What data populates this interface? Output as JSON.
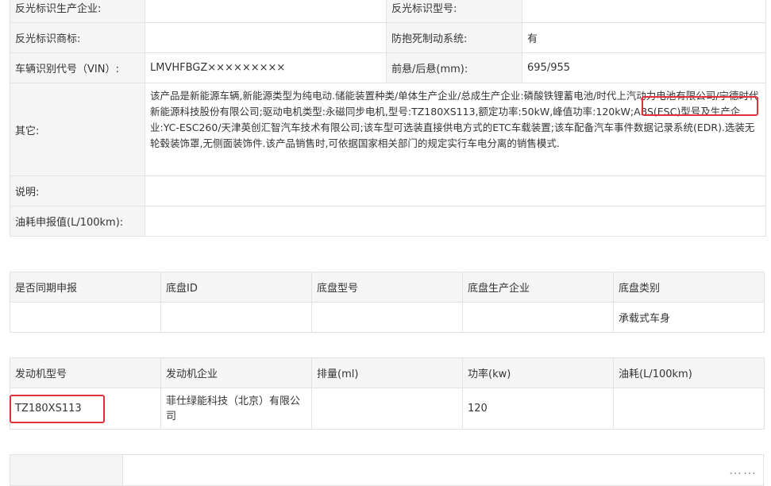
{
  "spec": {
    "rows": [
      {
        "l1": "反光标识生产企业:",
        "v1": "",
        "l2": "反光标识型号:",
        "v2": ""
      },
      {
        "l1": "反光标识商标:",
        "v1": "",
        "l2": "防抱死制动系统:",
        "v2": "有"
      },
      {
        "l1": "车辆识别代号（VIN）:",
        "v1": "LMVHFBGZ×××××××××",
        "l2": "前悬/后悬(mm):",
        "v2": "695/955"
      }
    ],
    "other_label": "其它:",
    "other_text": "该产品是新能源车辆,新能源类型为纯电动.储能装置种类/单体生产企业/总成生产企业:磷酸铁锂蓄电池/时代上汽动力电池有限公司/宁德时代新能源科技股份有限公司;驱动电机类型:永磁同步电机,型号:TZ180XS113,额定功率:50kW,峰值功率:120kW;ABS(ESC)型号及生产企业:YC-ESC260/天津英创汇智汽车技术有限公司;该车型可选装直接供电方式的ETC车载装置;该车配备汽车事件数据记录系统(EDR).选装无轮毂装饰罩,无侧面装饰件.该产品销售时,可依据国家相关部门的规定实行车电分离的销售模式.",
    "note_label": "说明:",
    "note_value": "",
    "fuel_label": "油耗申报值(L/100km):",
    "fuel_value": ""
  },
  "chassis": {
    "headers": [
      "是否同期申报",
      "底盘ID",
      "底盘型号",
      "底盘生产企业",
      "底盘类别"
    ],
    "values": [
      "",
      "",
      "",
      "",
      "承载式车身"
    ]
  },
  "engine": {
    "headers": [
      "发动机型号",
      "发动机企业",
      "排量(ml)",
      "功率(kw)",
      "油耗(L/100km)"
    ],
    "values": [
      "TZ180XS113",
      "菲仕绿能科技（北京）有限公司",
      "",
      "120",
      ""
    ]
  },
  "colors": {
    "highlight": "#e0303a",
    "label_bg": "#f5f5f5",
    "border": "#e2e2e2"
  },
  "icons": {
    "more": "more-dots-icon"
  }
}
